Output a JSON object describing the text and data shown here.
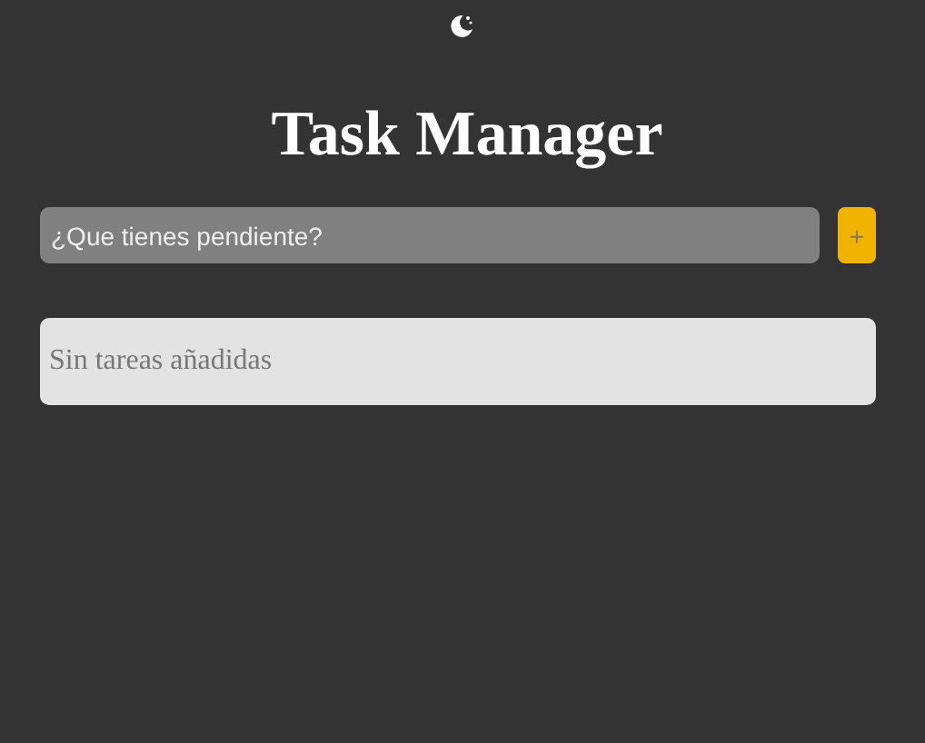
{
  "title": "Task Manager",
  "new_task": {
    "placeholder": "¿Que tienes pendiente?",
    "add_button": "+"
  },
  "task_list": {
    "empty_message": "Sin tareas añadidas"
  }
}
